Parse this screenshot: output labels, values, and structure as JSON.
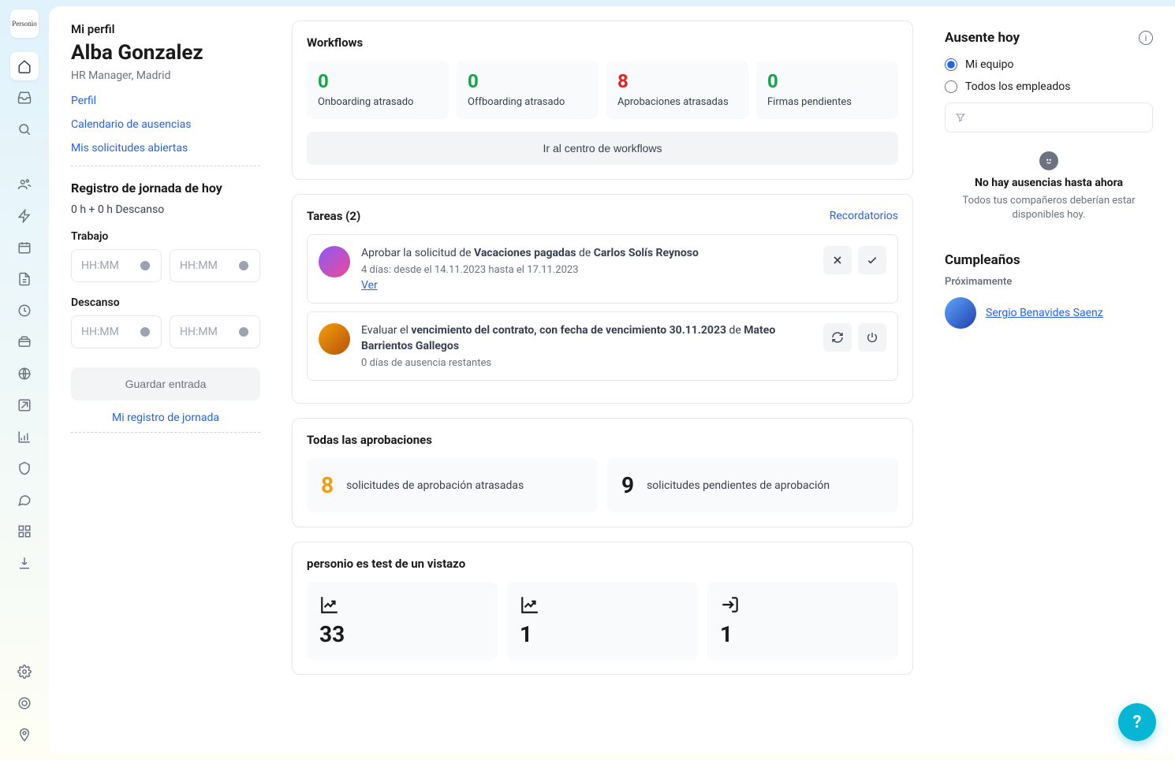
{
  "nav": {
    "logo": "Personio"
  },
  "profile": {
    "heading": "Mi perfil",
    "name": "Alba Gonzalez",
    "role": "HR Manager, Madrid",
    "links": {
      "perfil": "Perfil",
      "calendario": "Calendario de ausencias",
      "solicitudes": "Mis solicitudes abiertas"
    }
  },
  "attendance": {
    "title": "Registro de jornada de hoy",
    "summary": "0 h + 0 h Descanso",
    "work_label": "Trabajo",
    "break_label": "Descanso",
    "placeholder": "HH:MM",
    "save_label": "Guardar entrada",
    "log_link": "Mi registro de jornada"
  },
  "workflows": {
    "title": "Workflows",
    "tiles": [
      {
        "num": "0",
        "color": "green",
        "label": "Onboarding atrasado"
      },
      {
        "num": "0",
        "color": "green",
        "label": "Offboarding atrasado"
      },
      {
        "num": "8",
        "color": "red",
        "label": "Aprobaciones atrasadas"
      },
      {
        "num": "0",
        "color": "green",
        "label": "Firmas pendientes"
      }
    ],
    "cta": "Ir al centro de workflows"
  },
  "tasks": {
    "title": "Tareas (2)",
    "reminders": "Recordatorios",
    "task1": {
      "pre": "Aprobar la solicitud de ",
      "bold1": "Vacaciones pagadas",
      "mid": " de ",
      "bold2": "Carlos Solís Reynoso",
      "sub": "4 días: desde el 14.11.2023 hasta el 17.11.2023",
      "view": "Ver"
    },
    "task2": {
      "pre": "Evaluar el ",
      "bold1": "vencimiento del contrato, con fecha de vencimiento 30.11.2023",
      "mid": " de ",
      "bold2": "Mateo Barrientos Gallegos",
      "sub": "0 días de ausencia restantes"
    }
  },
  "approvals": {
    "title": "Todas las aprobaciones",
    "tile1": {
      "num": "8",
      "label": "solicitudes de aprobación atrasadas"
    },
    "tile2": {
      "num": "9",
      "label": "solicitudes pendientes de aprobación"
    }
  },
  "glance": {
    "title": "personio es test de un vistazo",
    "tiles": [
      {
        "num": "33"
      },
      {
        "num": "1"
      },
      {
        "num": "1"
      }
    ]
  },
  "absent": {
    "title": "Ausente hoy",
    "radio1": "Mi equipo",
    "radio2": "Todos los empleados",
    "empty_title": "No hay ausencias hasta ahora",
    "empty_sub": "Todos tus compañeros deberían estar disponibles hoy."
  },
  "birthdays": {
    "title": "Cumpleaños",
    "soon": "Próximamente",
    "person": "Sergio Benavides Saenz"
  },
  "help": "?"
}
